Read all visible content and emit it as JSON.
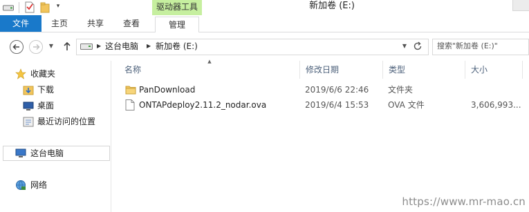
{
  "window": {
    "title": "新加卷 (E:)",
    "context_group": "驱动器工具"
  },
  "ribbon": {
    "tabs": [
      "文件",
      "主页",
      "共享",
      "查看"
    ],
    "context_tab": "管理"
  },
  "address": {
    "crumbs": [
      "这台电脑",
      "新加卷 (E:)"
    ],
    "search_placeholder": "搜索\"新加卷 (E:)\""
  },
  "nav": {
    "favorites_label": "收藏夹",
    "favorites": [
      "下载",
      "桌面",
      "最近访问的位置"
    ],
    "this_pc": "这台电脑",
    "network": "网络"
  },
  "columns": [
    "名称",
    "修改日期",
    "类型",
    "大小"
  ],
  "files": [
    {
      "name": "PanDownload",
      "modified": "2019/6/6 22:46",
      "type": "文件夹",
      "size": "",
      "icon": "folder-icon"
    },
    {
      "name": "ONTAPdeploy2.11.2_nodar.ova",
      "modified": "2019/6/4 15:53",
      "type": "OVA 文件",
      "size": "3,606,993...",
      "icon": "file-icon"
    }
  ],
  "watermark": "https://www.mr-mao.cn",
  "colors": {
    "file_tab": "#1979ca",
    "context_band": "#c6ef9f",
    "folder": "#f2c55c"
  }
}
